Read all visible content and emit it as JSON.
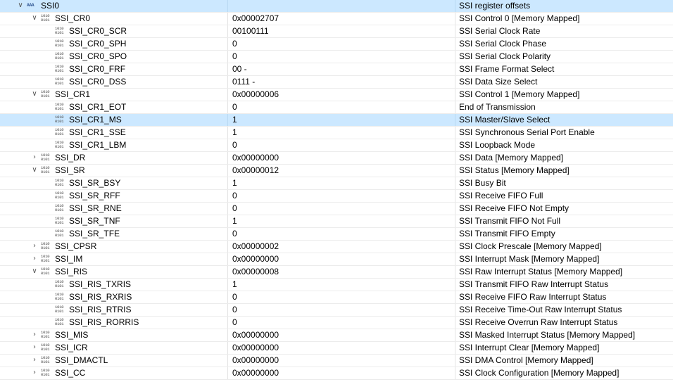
{
  "rows": [
    {
      "level": 0,
      "expander": "expanded",
      "icon": "peripheral-icon",
      "name": "SSI0",
      "value": "",
      "desc": "SSI register offsets",
      "selected": true
    },
    {
      "level": 1,
      "expander": "expanded",
      "icon": "register-icon",
      "name": "SSI_CR0",
      "value": "0x00002707",
      "desc": "SSI Control 0 [Memory Mapped]"
    },
    {
      "level": 2,
      "expander": "none",
      "icon": "register-icon",
      "name": "SSI_CR0_SCR",
      "value": "00100111",
      "desc": "SSI Serial Clock Rate"
    },
    {
      "level": 2,
      "expander": "none",
      "icon": "register-icon",
      "name": "SSI_CR0_SPH",
      "value": "0",
      "desc": "SSI Serial Clock Phase"
    },
    {
      "level": 2,
      "expander": "none",
      "icon": "register-icon",
      "name": "SSI_CR0_SPO",
      "value": "0",
      "desc": "SSI Serial Clock Polarity"
    },
    {
      "level": 2,
      "expander": "none",
      "icon": "register-icon",
      "name": "SSI_CR0_FRF",
      "value": "00 -",
      "desc": "SSI Frame Format Select"
    },
    {
      "level": 2,
      "expander": "none",
      "icon": "register-icon",
      "name": "SSI_CR0_DSS",
      "value": "0111 -",
      "desc": "SSI Data Size Select"
    },
    {
      "level": 1,
      "expander": "expanded",
      "icon": "register-icon",
      "name": "SSI_CR1",
      "value": "0x00000006",
      "desc": "SSI Control 1 [Memory Mapped]"
    },
    {
      "level": 2,
      "expander": "none",
      "icon": "register-icon",
      "name": "SSI_CR1_EOT",
      "value": "0",
      "desc": "End of Transmission"
    },
    {
      "level": 2,
      "expander": "none",
      "icon": "register-icon",
      "name": "SSI_CR1_MS",
      "value": "1",
      "desc": "SSI Master/Slave Select",
      "selected": true
    },
    {
      "level": 2,
      "expander": "none",
      "icon": "register-icon",
      "name": "SSI_CR1_SSE",
      "value": "1",
      "desc": "SSI Synchronous Serial Port Enable"
    },
    {
      "level": 2,
      "expander": "none",
      "icon": "register-icon",
      "name": "SSI_CR1_LBM",
      "value": "0",
      "desc": "SSI Loopback Mode"
    },
    {
      "level": 1,
      "expander": "collapsed",
      "icon": "register-icon",
      "name": "SSI_DR",
      "value": "0x00000000",
      "desc": "SSI Data [Memory Mapped]"
    },
    {
      "level": 1,
      "expander": "expanded",
      "icon": "register-icon",
      "name": "SSI_SR",
      "value": "0x00000012",
      "desc": "SSI Status [Memory Mapped]"
    },
    {
      "level": 2,
      "expander": "none",
      "icon": "register-icon",
      "name": "SSI_SR_BSY",
      "value": "1",
      "desc": "SSI Busy Bit"
    },
    {
      "level": 2,
      "expander": "none",
      "icon": "register-icon",
      "name": "SSI_SR_RFF",
      "value": "0",
      "desc": "SSI Receive FIFO Full"
    },
    {
      "level": 2,
      "expander": "none",
      "icon": "register-icon",
      "name": "SSI_SR_RNE",
      "value": "0",
      "desc": "SSI Receive FIFO Not Empty"
    },
    {
      "level": 2,
      "expander": "none",
      "icon": "register-icon",
      "name": "SSI_SR_TNF",
      "value": "1",
      "desc": "SSI Transmit FIFO Not Full"
    },
    {
      "level": 2,
      "expander": "none",
      "icon": "register-icon",
      "name": "SSI_SR_TFE",
      "value": "0",
      "desc": "SSI Transmit FIFO Empty"
    },
    {
      "level": 1,
      "expander": "collapsed",
      "icon": "register-icon",
      "name": "SSI_CPSR",
      "value": "0x00000002",
      "desc": "SSI Clock Prescale [Memory Mapped]"
    },
    {
      "level": 1,
      "expander": "collapsed",
      "icon": "register-icon",
      "name": "SSI_IM",
      "value": "0x00000000",
      "desc": "SSI Interrupt Mask [Memory Mapped]"
    },
    {
      "level": 1,
      "expander": "expanded",
      "icon": "register-icon",
      "name": "SSI_RIS",
      "value": "0x00000008",
      "desc": "SSI Raw Interrupt Status [Memory Mapped]"
    },
    {
      "level": 2,
      "expander": "none",
      "icon": "register-icon",
      "name": "SSI_RIS_TXRIS",
      "value": "1",
      "desc": "SSI Transmit FIFO Raw Interrupt Status"
    },
    {
      "level": 2,
      "expander": "none",
      "icon": "register-icon",
      "name": "SSI_RIS_RXRIS",
      "value": "0",
      "desc": "SSI Receive FIFO Raw Interrupt Status"
    },
    {
      "level": 2,
      "expander": "none",
      "icon": "register-icon",
      "name": "SSI_RIS_RTRIS",
      "value": "0",
      "desc": "SSI Receive Time-Out Raw Interrupt Status"
    },
    {
      "level": 2,
      "expander": "none",
      "icon": "register-icon",
      "name": "SSI_RIS_RORRIS",
      "value": "0",
      "desc": "SSI Receive Overrun Raw Interrupt Status"
    },
    {
      "level": 1,
      "expander": "collapsed",
      "icon": "register-icon",
      "name": "SSI_MIS",
      "value": "0x00000000",
      "desc": "SSI Masked Interrupt Status [Memory Mapped]"
    },
    {
      "level": 1,
      "expander": "collapsed",
      "icon": "register-icon",
      "name": "SSI_ICR",
      "value": "0x00000000",
      "desc": "SSI Interrupt Clear [Memory Mapped]"
    },
    {
      "level": 1,
      "expander": "collapsed",
      "icon": "register-icon",
      "name": "SSI_DMACTL",
      "value": "0x00000000",
      "desc": "SSI DMA Control [Memory Mapped]"
    },
    {
      "level": 1,
      "expander": "collapsed",
      "icon": "register-icon",
      "name": "SSI_CC",
      "value": "0x00000000",
      "desc": "SSI Clock Configuration [Memory Mapped]"
    }
  ],
  "icons": {
    "register": "1010\n0101",
    "peripheral": "AAA"
  },
  "glyphs": {
    "expanded": "∨",
    "collapsed": "›"
  },
  "colors": {
    "selection": "#cce8ff",
    "grid": "#e3e3e3",
    "icon": "#444444"
  }
}
